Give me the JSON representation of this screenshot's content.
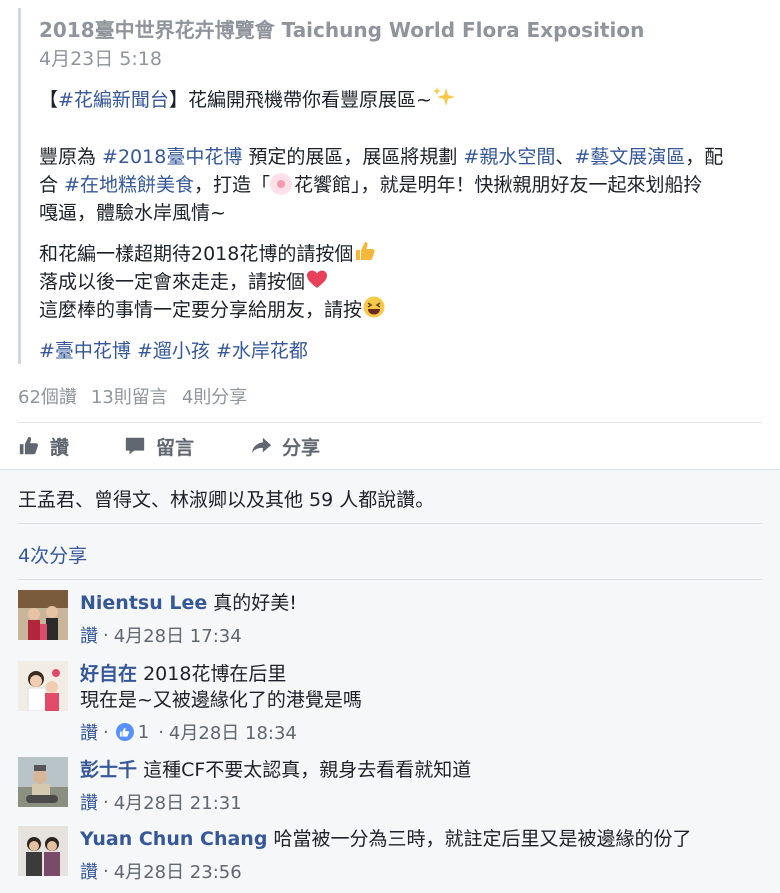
{
  "post": {
    "page_name": "2018臺中世界花卉博覽會 Taichung World Flora Exposition",
    "date": "4月23日 5:18",
    "line1": {
      "bracket_open": "【",
      "tag": "#花編新聞台",
      "rest": "】花編開飛機帶你看豐原展區~"
    },
    "line2": {
      "p1": "豐原為 ",
      "t1": "#2018臺中花博",
      "p2": " 預定的展區，展區將規劃 ",
      "t2": "#親水空間",
      "p3": "、",
      "t3": "#藝文展演區",
      "p4": "，配"
    },
    "line3": {
      "p1": "合 ",
      "t1": "#在地糕餅美食",
      "p2": "，打造「",
      "p3": "花饗館」，就是明年！快揪親朋好友一起來划船拎"
    },
    "line4": "嘎逼，體驗水岸風情~",
    "line5": "和花編一樣超期待2018花博的請按個",
    "line6": "落成以後一定會來走走，請按個",
    "line7": "這麼棒的事情一定要分享給朋友，請按",
    "hashtags": [
      "#臺中花博",
      "#遛小孩",
      "#水岸花都"
    ]
  },
  "stats": {
    "likes": "62個讚",
    "comments": "13則留言",
    "shares": "4則分享"
  },
  "actions": {
    "like": "讚",
    "comment": "留言",
    "share": "分享"
  },
  "like_summary": "王孟君、曾得文、林淑卿以及其他 59 人都說讚。",
  "share_count": "4次分享",
  "comments": [
    {
      "name": "Nientsu Lee",
      "text": "真的好美!",
      "text2": "",
      "like": "讚",
      "reactions": "",
      "time": "4月28日 17:34"
    },
    {
      "name": "好自在",
      "text": "2018花博在后里",
      "text2": "現在是~又被邊緣化了的港覺是嗎",
      "like": "讚",
      "reactions": "1",
      "time": "4月28日 18:34"
    },
    {
      "name": "彭士千",
      "text": "這種CF不要太認真，親身去看看就知道",
      "text2": "",
      "like": "讚",
      "reactions": "",
      "time": "4月28日 21:31"
    },
    {
      "name": "Yuan Chun Chang",
      "text": "哈當被一分為三時，就註定后里又是被邊緣的份了",
      "text2": "",
      "like": "讚",
      "reactions": "",
      "time": "4月28日 23:56"
    }
  ],
  "meta_sep": "·",
  "colors": {
    "link": "#365899",
    "muted": "#90949c",
    "text": "#1d2129",
    "lower_bg": "#f6f7f9"
  }
}
